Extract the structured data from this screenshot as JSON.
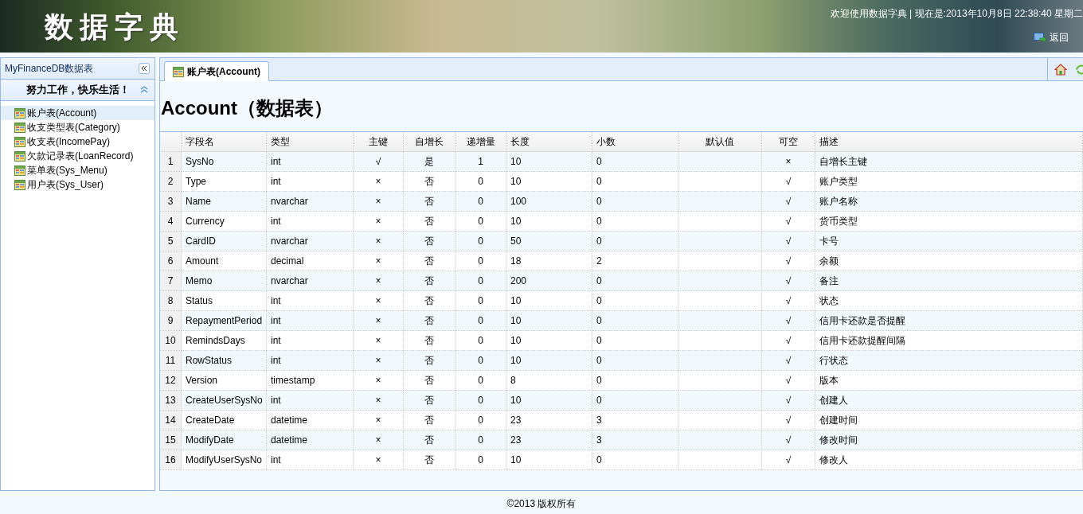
{
  "header": {
    "title": "数据字典",
    "welcome": "欢迎使用数据字典 | 现在是:2013年10月8日 22:38:40 星期二",
    "back_link": "返回"
  },
  "sidebar": {
    "title": "MyFinanceDB数据表",
    "section": {
      "title": "努力工作，快乐生活！",
      "expanded": true
    },
    "items": [
      {
        "label": "账户表(Account)",
        "selected": true
      },
      {
        "label": "收支类型表(Category)",
        "selected": false
      },
      {
        "label": "收支表(IncomePay)",
        "selected": false
      },
      {
        "label": "欠款记录表(LoanRecord)",
        "selected": false
      },
      {
        "label": "菜单表(Sys_Menu)",
        "selected": false
      },
      {
        "label": "用户表(Sys_User)",
        "selected": false
      }
    ]
  },
  "tabs": [
    {
      "label": "账户表(Account)",
      "selected": true
    }
  ],
  "page_heading": "Account（数据表）",
  "table": {
    "columns": [
      "",
      "字段名",
      "类型",
      "主键",
      "自增长",
      "递增量",
      "长度",
      "小数",
      "默认值",
      "可空",
      "描述"
    ],
    "rows": [
      [
        "1",
        "SysNo",
        "int",
        "√",
        "是",
        "1",
        "10",
        "0",
        "",
        "×",
        "自增长主键"
      ],
      [
        "2",
        "Type",
        "int",
        "×",
        "否",
        "0",
        "10",
        "0",
        "",
        "√",
        "账户类型"
      ],
      [
        "3",
        "Name",
        "nvarchar",
        "×",
        "否",
        "0",
        "100",
        "0",
        "",
        "√",
        "账户名称"
      ],
      [
        "4",
        "Currency",
        "int",
        "×",
        "否",
        "0",
        "10",
        "0",
        "",
        "√",
        "货币类型"
      ],
      [
        "5",
        "CardID",
        "nvarchar",
        "×",
        "否",
        "0",
        "50",
        "0",
        "",
        "√",
        "卡号"
      ],
      [
        "6",
        "Amount",
        "decimal",
        "×",
        "否",
        "0",
        "18",
        "2",
        "",
        "√",
        "余额"
      ],
      [
        "7",
        "Memo",
        "nvarchar",
        "×",
        "否",
        "0",
        "200",
        "0",
        "",
        "√",
        "备注"
      ],
      [
        "8",
        "Status",
        "int",
        "×",
        "否",
        "0",
        "10",
        "0",
        "",
        "√",
        "状态"
      ],
      [
        "9",
        "RepaymentPeriod",
        "int",
        "×",
        "否",
        "0",
        "10",
        "0",
        "",
        "√",
        "信用卡还款是否提醒"
      ],
      [
        "10",
        "RemindsDays",
        "int",
        "×",
        "否",
        "0",
        "10",
        "0",
        "",
        "√",
        "信用卡还款提醒间隔"
      ],
      [
        "11",
        "RowStatus",
        "int",
        "×",
        "否",
        "0",
        "10",
        "0",
        "",
        "√",
        "行状态"
      ],
      [
        "12",
        "Version",
        "timestamp",
        "×",
        "否",
        "0",
        "8",
        "0",
        "",
        "√",
        "版本"
      ],
      [
        "13",
        "CreateUserSysNo",
        "int",
        "×",
        "否",
        "0",
        "10",
        "0",
        "",
        "√",
        "创建人"
      ],
      [
        "14",
        "CreateDate",
        "datetime",
        "×",
        "否",
        "0",
        "23",
        "3",
        "",
        "√",
        "创建时间"
      ],
      [
        "15",
        "ModifyDate",
        "datetime",
        "×",
        "否",
        "0",
        "23",
        "3",
        "",
        "√",
        "修改时间"
      ],
      [
        "16",
        "ModifyUserSysNo",
        "int",
        "×",
        "否",
        "0",
        "10",
        "0",
        "",
        "√",
        "修改人"
      ]
    ]
  },
  "footer": "©2013 版权所有"
}
